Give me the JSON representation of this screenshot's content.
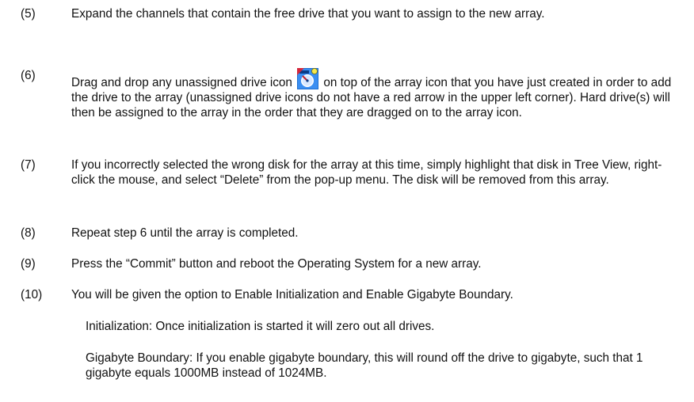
{
  "steps": [
    {
      "num": "(5)",
      "text": "Expand the channels that contain the free drive that you want to assign to the new array."
    },
    {
      "num": "(6)",
      "text_before": "Drag and drop any unassigned drive icon",
      "icon": "unassigned-drive-icon",
      "text_after": "on top of the array icon that you have just created in order to add the drive to the array (unassigned drive icons do not have a red arrow in the upper left corner). Hard drive(s) will then be assigned to the array in the order that they are dragged on to the array icon."
    },
    {
      "num": "(7)",
      "text": "If you incorrectly selected the wrong disk for the array at this time, simply highlight that disk in Tree View, right-click the mouse, and select “Delete” from the pop-up menu. The disk will be removed from this array."
    },
    {
      "num": "(8)",
      "text": "Repeat step 6 until the array is completed."
    },
    {
      "num": "(9)",
      "text": "Press the “Commit” button and reboot the Operating System for a new array."
    },
    {
      "num": "(10)",
      "text": "You will be given the option to Enable Initialization and Enable Gigabyte Boundary."
    }
  ],
  "notes": {
    "initialization": "Initialization: Once initialization is started it will zero out all drives.",
    "gigabyte": "Gigabyte Boundary: If you enable gigabyte boundary, this will round off the drive to gigabyte, such that 1 gigabyte equals 1000MB instead of 1024MB."
  }
}
